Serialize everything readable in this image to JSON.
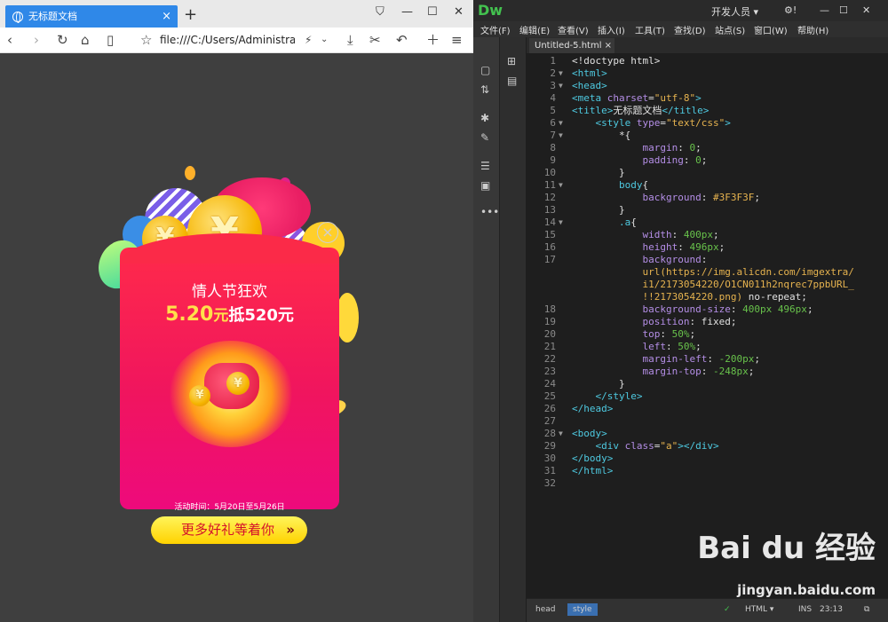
{
  "browser": {
    "tab_title": "无标题文档",
    "tab_close": "×",
    "new_tab": "+",
    "url": "file:///C:/Users/Administrator",
    "window": {
      "minimize": "—",
      "maximize": "☐",
      "close": "✕"
    }
  },
  "page": {
    "title": "情人节狂欢",
    "price": "5.20",
    "price_unit": "元",
    "offset_text": "抵520元",
    "period": "活动时间：5月20日至5月26日",
    "cta": "更多好礼等着你",
    "close": "×"
  },
  "dw": {
    "logo": "Dw",
    "workspace": "开发人员",
    "menus": [
      "文件(F)",
      "编辑(E)",
      "查看(V)",
      "插入(I)",
      "工具(T)",
      "查找(D)",
      "站点(S)",
      "窗口(W)",
      "帮助(H)"
    ],
    "doc_tab": "Untitled-5.html",
    "doc_tab_close": "×",
    "code_lines": [
      {
        "n": "1",
        "f": "",
        "t": [
          [
            "sel",
            "<!doctype html>"
          ]
        ]
      },
      {
        "n": "2",
        "f": "▼",
        "t": [
          [
            "tag",
            "<html>"
          ]
        ]
      },
      {
        "n": "3",
        "f": "▼",
        "t": [
          [
            "tag",
            "<head>"
          ]
        ]
      },
      {
        "n": "4",
        "f": "",
        "t": [
          [
            "tag",
            "<meta "
          ],
          [
            "attr",
            "charset"
          ],
          [
            "sel",
            "="
          ],
          [
            "str",
            "\"utf-8\""
          ],
          [
            "tag",
            ">"
          ]
        ]
      },
      {
        "n": "5",
        "f": "",
        "t": [
          [
            "tag",
            "<title>"
          ],
          [
            "sel",
            "无标题文档"
          ],
          [
            "tag",
            "</title>"
          ]
        ]
      },
      {
        "n": "6",
        "f": "▼",
        "t": [
          [
            "sel",
            "    "
          ],
          [
            "tag",
            "<style "
          ],
          [
            "attr",
            "type"
          ],
          [
            "sel",
            "="
          ],
          [
            "str",
            "\"text/css\""
          ],
          [
            "tag",
            ">"
          ]
        ]
      },
      {
        "n": "7",
        "f": "▼",
        "t": [
          [
            "sel",
            "        *{"
          ]
        ]
      },
      {
        "n": "8",
        "f": "",
        "t": [
          [
            "sel",
            "            "
          ],
          [
            "attr",
            "margin"
          ],
          [
            "sel",
            ": "
          ],
          [
            "num",
            "0"
          ],
          [
            "sel",
            ";"
          ]
        ]
      },
      {
        "n": "9",
        "f": "",
        "t": [
          [
            "sel",
            "            "
          ],
          [
            "attr",
            "padding"
          ],
          [
            "sel",
            ": "
          ],
          [
            "num",
            "0"
          ],
          [
            "sel",
            ";"
          ]
        ]
      },
      {
        "n": "10",
        "f": "",
        "t": [
          [
            "sel",
            "        }"
          ]
        ]
      },
      {
        "n": "11",
        "f": "▼",
        "t": [
          [
            "sel",
            "        "
          ],
          [
            "tag",
            "body"
          ],
          [
            "sel",
            "{"
          ]
        ]
      },
      {
        "n": "12",
        "f": "",
        "t": [
          [
            "sel",
            "            "
          ],
          [
            "attr",
            "background"
          ],
          [
            "sel",
            ": "
          ],
          [
            "str",
            "#3F3F3F"
          ],
          [
            "sel",
            ";"
          ]
        ]
      },
      {
        "n": "13",
        "f": "",
        "t": [
          [
            "sel",
            "        }"
          ]
        ]
      },
      {
        "n": "14",
        "f": "▼",
        "t": [
          [
            "sel",
            "        "
          ],
          [
            "tag",
            ".a"
          ],
          [
            "sel",
            "{"
          ]
        ]
      },
      {
        "n": "15",
        "f": "",
        "t": [
          [
            "sel",
            "            "
          ],
          [
            "attr",
            "width"
          ],
          [
            "sel",
            ": "
          ],
          [
            "num",
            "400px"
          ],
          [
            "sel",
            ";"
          ]
        ]
      },
      {
        "n": "16",
        "f": "",
        "t": [
          [
            "sel",
            "            "
          ],
          [
            "attr",
            "height"
          ],
          [
            "sel",
            ": "
          ],
          [
            "num",
            "496px"
          ],
          [
            "sel",
            ";"
          ]
        ]
      },
      {
        "n": "17",
        "f": "",
        "t": [
          [
            "sel",
            "            "
          ],
          [
            "attr",
            "background"
          ],
          [
            "sel",
            ":"
          ]
        ]
      },
      {
        "n": "",
        "f": "",
        "t": [
          [
            "sel",
            "            "
          ],
          [
            "str",
            "url(https://img.alicdn.com/imgextra/"
          ]
        ]
      },
      {
        "n": "",
        "f": "",
        "t": [
          [
            "sel",
            "            "
          ],
          [
            "str",
            "i1/2173054220/O1CN011h2nqrec7ppbURL_"
          ]
        ]
      },
      {
        "n": "",
        "f": "",
        "t": [
          [
            "sel",
            "            "
          ],
          [
            "str",
            "!!2173054220.png)"
          ],
          [
            "sel",
            " no-repeat;"
          ]
        ]
      },
      {
        "n": "18",
        "f": "",
        "t": [
          [
            "sel",
            "            "
          ],
          [
            "attr",
            "background-size"
          ],
          [
            "sel",
            ": "
          ],
          [
            "num",
            "400px 496px"
          ],
          [
            "sel",
            ";"
          ]
        ]
      },
      {
        "n": "19",
        "f": "",
        "t": [
          [
            "sel",
            "            "
          ],
          [
            "attr",
            "position"
          ],
          [
            "sel",
            ": fixed;"
          ]
        ]
      },
      {
        "n": "20",
        "f": "",
        "t": [
          [
            "sel",
            "            "
          ],
          [
            "attr",
            "top"
          ],
          [
            "sel",
            ": "
          ],
          [
            "num",
            "50%"
          ],
          [
            "sel",
            ";"
          ]
        ]
      },
      {
        "n": "21",
        "f": "",
        "t": [
          [
            "sel",
            "            "
          ],
          [
            "attr",
            "left"
          ],
          [
            "sel",
            ": "
          ],
          [
            "num",
            "50%"
          ],
          [
            "sel",
            ";"
          ]
        ]
      },
      {
        "n": "22",
        "f": "",
        "t": [
          [
            "sel",
            "            "
          ],
          [
            "attr",
            "margin-left"
          ],
          [
            "sel",
            ": "
          ],
          [
            "num",
            "-200px"
          ],
          [
            "sel",
            ";"
          ]
        ]
      },
      {
        "n": "23",
        "f": "",
        "t": [
          [
            "sel",
            "            "
          ],
          [
            "attr",
            "margin-top"
          ],
          [
            "sel",
            ": "
          ],
          [
            "num",
            "-248px"
          ],
          [
            "sel",
            ";"
          ]
        ]
      },
      {
        "n": "24",
        "f": "",
        "t": [
          [
            "sel",
            "        }"
          ]
        ]
      },
      {
        "n": "25",
        "f": "",
        "t": [
          [
            "sel",
            "    "
          ],
          [
            "tag",
            "</style>"
          ]
        ]
      },
      {
        "n": "26",
        "f": "",
        "t": [
          [
            "tag",
            "</head>"
          ]
        ]
      },
      {
        "n": "27",
        "f": "",
        "t": []
      },
      {
        "n": "28",
        "f": "▼",
        "t": [
          [
            "tag",
            "<body>"
          ]
        ]
      },
      {
        "n": "29",
        "f": "",
        "t": [
          [
            "sel",
            "    "
          ],
          [
            "tag",
            "<div "
          ],
          [
            "attr",
            "class"
          ],
          [
            "sel",
            "="
          ],
          [
            "str",
            "\"a\""
          ],
          [
            "tag",
            "></div>"
          ]
        ]
      },
      {
        "n": "30",
        "f": "",
        "t": [
          [
            "tag",
            "</body>"
          ]
        ]
      },
      {
        "n": "31",
        "f": "",
        "t": [
          [
            "tag",
            "</html>"
          ]
        ]
      },
      {
        "n": "32",
        "f": "",
        "t": []
      }
    ],
    "status": {
      "crumb1": "head",
      "crumb2": "style",
      "mode": "HTML",
      "ins": "INS",
      "pos": "23:13"
    },
    "watermark": {
      "brand": "Bai du 经验",
      "url": "jingyan.baidu.com"
    }
  },
  "colors": {
    "browser_tab": "#2f88e8",
    "card_top": "#ff2a4a",
    "card_bottom": "#ee0a7c",
    "cta": "#ffd200",
    "dw_green": "#43c24f"
  }
}
